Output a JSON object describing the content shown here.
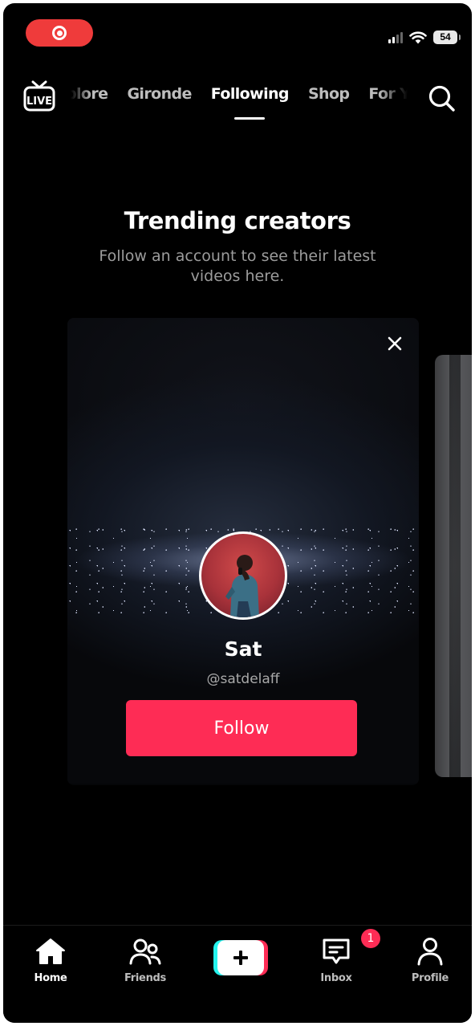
{
  "status_bar": {
    "battery_level": "54"
  },
  "top_nav": {
    "live_icon": "live-tv-icon",
    "tabs": [
      {
        "label": "plore"
      },
      {
        "label": "Gironde"
      },
      {
        "label": "Following",
        "active": true
      },
      {
        "label": "Shop"
      },
      {
        "label": "For You"
      }
    ],
    "search_icon": "search-icon"
  },
  "main": {
    "title": "Trending creators",
    "subtitle": "Follow an account to see their latest videos here."
  },
  "creator_card": {
    "name": "Sat",
    "handle": "@satdelaff",
    "follow_label": "Follow"
  },
  "bottom_nav": {
    "items": [
      {
        "label": "Home",
        "icon": "home-icon",
        "active": true
      },
      {
        "label": "Friends",
        "icon": "friends-icon"
      },
      {
        "label": "",
        "icon": "plus-icon"
      },
      {
        "label": "Inbox",
        "icon": "inbox-icon",
        "badge": "1"
      },
      {
        "label": "Profile",
        "icon": "profile-icon"
      }
    ]
  },
  "colors": {
    "accent": "#fe2c55",
    "accent_cyan": "#25f4ee",
    "record_pill": "#ef3b3b",
    "background": "#000000"
  }
}
